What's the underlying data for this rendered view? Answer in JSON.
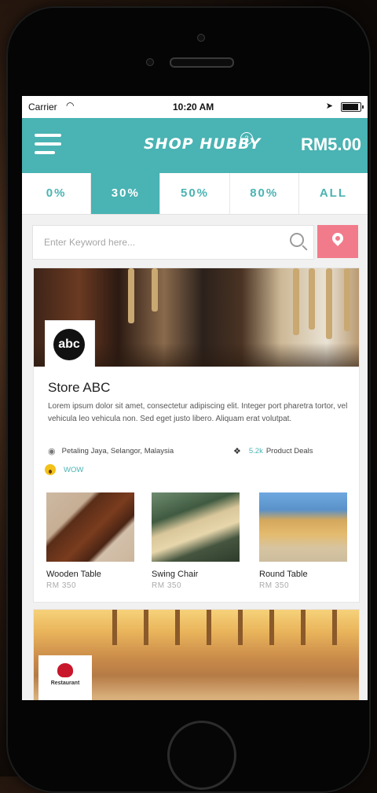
{
  "status_bar": {
    "carrier": "Carrier",
    "time": "10:20 AM"
  },
  "header": {
    "logo": "SHOP HUBBY",
    "badge": "3",
    "balance": "RM5.00"
  },
  "tabs": [
    {
      "label": "0%",
      "active": false
    },
    {
      "label": "30%",
      "active": true
    },
    {
      "label": "50%",
      "active": false
    },
    {
      "label": "80%",
      "active": false
    },
    {
      "label": "ALL",
      "active": false
    }
  ],
  "search": {
    "placeholder": "Enter Keyword here..."
  },
  "stores": [
    {
      "logo_text": "abc",
      "name": "Store ABC",
      "description": "Lorem ipsum dolor sit amet, consectetur adipiscing elit. Integer port pharetra tortor, vel vehicula leo vehicula non. Sed eget justo libero. Aliquam erat volutpat.",
      "location": "Petaling Jaya, Selangor, Malaysia",
      "deals_count": "5.2k",
      "deals_label": "Product Deals",
      "reaction": "WOW",
      "products": [
        {
          "name": "Wooden Table",
          "price": "RM 350"
        },
        {
          "name": "Swing Chair",
          "price": "RM 350"
        },
        {
          "name": "Round Table",
          "price": "RM 350"
        }
      ]
    },
    {
      "logo_text": "Restaurant"
    }
  ],
  "colors": {
    "accent": "#4ab3b3",
    "location_button": "#f17b8a"
  }
}
